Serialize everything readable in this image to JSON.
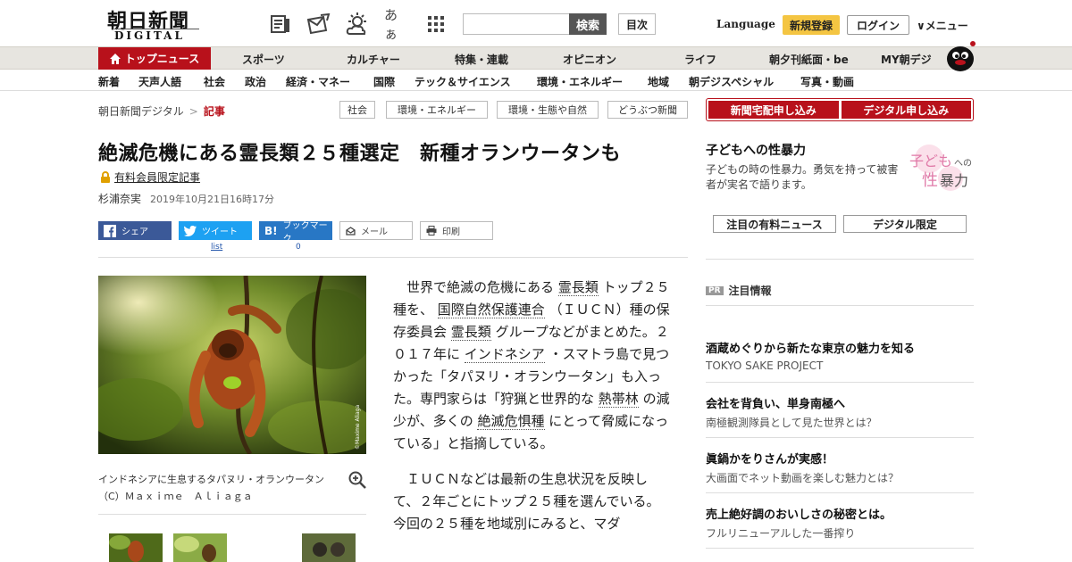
{
  "header": {
    "logo_jp": "朝日新聞",
    "logo_en": "DIGITAL",
    "search_placeholder": "",
    "search_button": "検索",
    "toc_button": "目次",
    "language": "Language",
    "register": "新規登録",
    "login": "ログイン",
    "menu": "∨メニュー",
    "font_icon_label": "あぁ"
  },
  "nav": {
    "top_news": "トップニュース",
    "items": [
      "スポーツ",
      "カルチャー",
      "特集・連載",
      "オピニオン",
      "ライフ",
      "朝夕刊紙面・be",
      "MY朝デジ"
    ]
  },
  "subnav": {
    "items": [
      "新着",
      "天声人語",
      "社会",
      "政治",
      "経済・マネー",
      "国際",
      "テック＆サイエンス",
      "環境・エネルギー",
      "地域",
      "朝デジスペシャル",
      "写真・動画"
    ]
  },
  "breadcrumb": {
    "site": "朝日新聞デジタル",
    "sep": ">",
    "current": "記事"
  },
  "tags": [
    "社会",
    "環境・エネルギー",
    "環境・生態や自然",
    "どうぶつ新聞"
  ],
  "article": {
    "title": "絶滅危機にある霊長類２５種選定　新種オランウータンも",
    "members_only": "有料会員限定記事",
    "author": "杉浦奈実",
    "date": "2019年10月21日16時17分",
    "share": {
      "facebook": "シェア",
      "twitter": "ツイート",
      "hatena": "ブックマーク",
      "mail": "メール",
      "print": "印刷",
      "twitter_count": "list",
      "hatena_count": "0"
    },
    "photo_credit": "©Maxime Aliaga",
    "caption": "インドネシアに生息するタパヌリ・オランウータン（C）Ｍａｘｉｍｅ　Ａｌｉａｇａ",
    "para1": {
      "a": "世界で絶滅の危機にある",
      "k1": "霊長類",
      "b": "トップ２５種を、",
      "k2": "国際自然保護連合",
      "c": "（ＩＵＣＮ）種の保存委員会",
      "k3": "霊長類",
      "d": "グループなどがまとめた。２０１７年に",
      "k4": "インドネシア",
      "e": "・スマトラ島で見つかった「タパヌリ・オランウータン」も入った。専門家らは「狩猟と世界的な",
      "k5": "熱帯林",
      "f": "の減少が、多くの",
      "k6": "絶滅危惧種",
      "g": "にとって脅威になっている」と指摘している。"
    },
    "para2": "ＩＵＣＮなどは最新の生息状況を反映して、２年ごとにトップ２５種を選んでいる。今回の２５種を地域別にみると、マダ"
  },
  "sidebar": {
    "delivery": "新聞宅配申し込み",
    "digital": "デジタル申し込み",
    "feature_title": "子どもへの性暴力",
    "feature_desc": "子どもの時の性暴力。勇気を持って被害者が実名で語ります。",
    "feature_img_a": "子ども",
    "feature_img_b": "への",
    "feature_img_c": "性",
    "feature_img_d": "暴力",
    "btn_paid": "注目の有料ニュース",
    "btn_digital": "デジタル限定",
    "pr_badge": "PR",
    "pr_label": "注目情報",
    "ads": [
      {
        "title": "酒蔵めぐりから新たな東京の魅力を知る",
        "sub": "TOKYO SAKE PROJECT"
      },
      {
        "title": "会社を背負い、単身南極へ",
        "sub": "南極観測隊員として見た世界とは？"
      },
      {
        "title": "眞鍋かをりさんが実感！",
        "sub": "大画面でネット動画を楽しむ魅力とは？"
      },
      {
        "title": "売上絶好調のおいしさの秘密とは。",
        "sub": "フルリニューアルした一番搾り"
      }
    ]
  },
  "colors": {
    "brand_red": "#b8111b",
    "register_yellow": "#f4c542",
    "facebook": "#3b5998",
    "twitter": "#1da1f2",
    "hatena": "#2877c5"
  }
}
